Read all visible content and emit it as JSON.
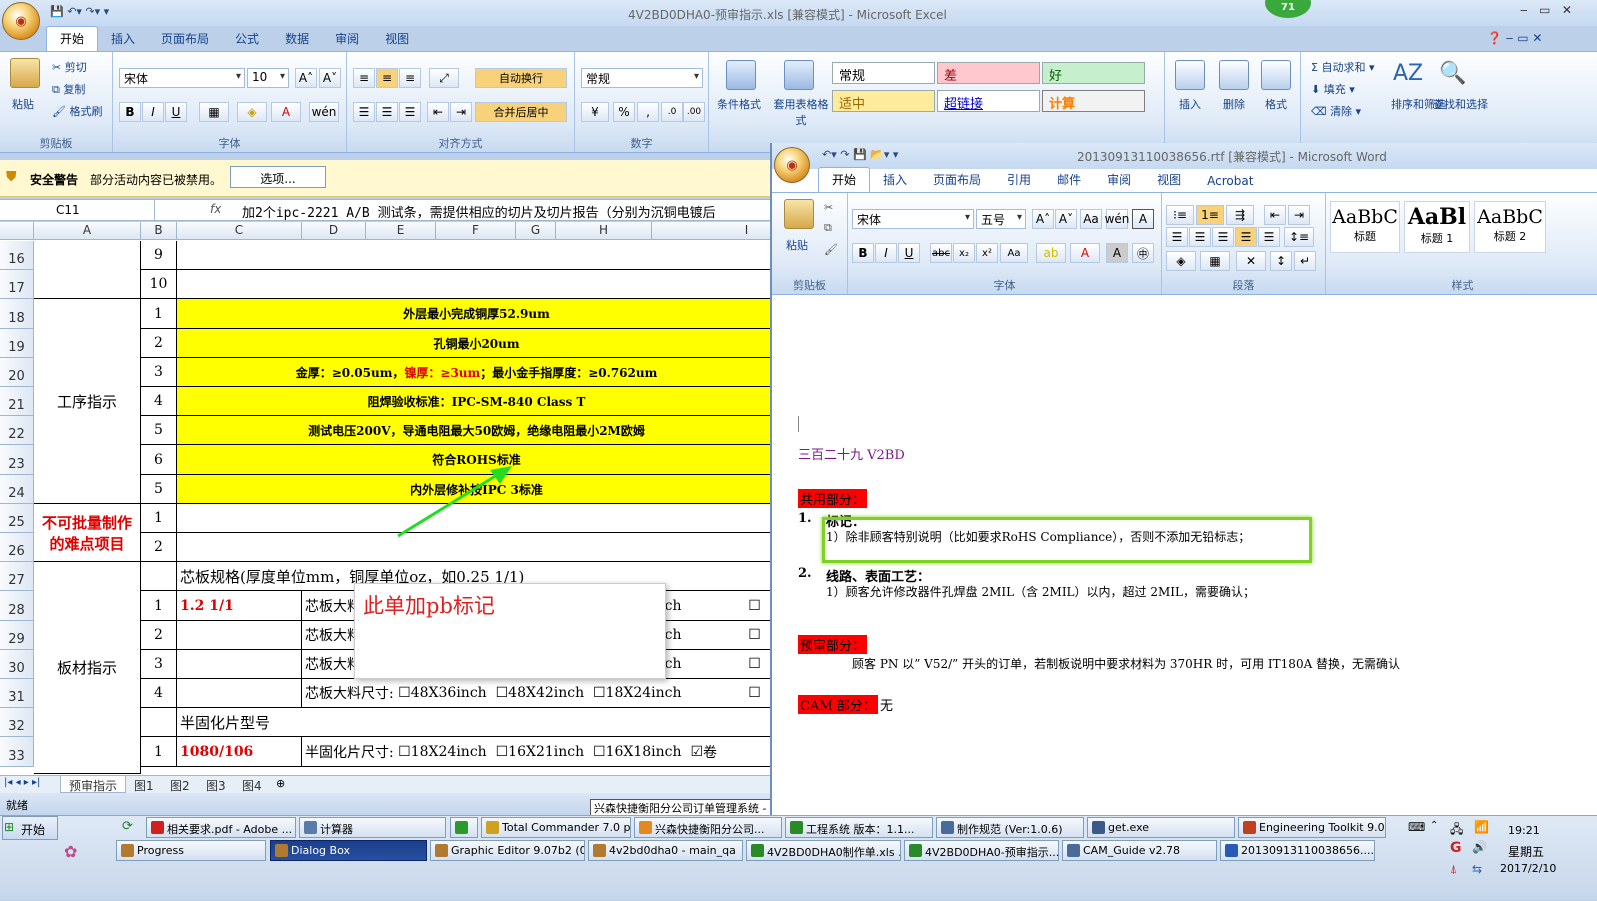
{
  "excel": {
    "title": "4V2BD0DHA0-预审指示.xls  [兼容模式] - Microsoft Excel",
    "tabs": [
      "开始",
      "插入",
      "页面布局",
      "公式",
      "数据",
      "审阅",
      "视图"
    ],
    "clipboard": {
      "paste": "粘贴",
      "cut": "剪切",
      "copy": "复制",
      "format_painter": "格式刷",
      "label": "剪贴板"
    },
    "font": {
      "name": "宋体",
      "size": "10",
      "label": "字体"
    },
    "align": {
      "wrap": "自动换行",
      "merge": "合并后居中",
      "label": "对齐方式"
    },
    "number": {
      "format": "常规",
      "label": "数字"
    },
    "styles": {
      "conditional": "条件格式",
      "table": "套用表格格式",
      "normal": "常规",
      "bad": "差",
      "good": "好",
      "neutral": "适中",
      "hyperlink": "超链接",
      "calc": "计算"
    },
    "cells": {
      "insert": "插入",
      "delete": "删除",
      "format": "格式"
    },
    "editing": {
      "autosum": "自动求和",
      "fill": "填充",
      "clear": "清除",
      "sort": "排序和筛选",
      "find": "查找和选择"
    },
    "security": {
      "title": "安全警告",
      "message": "部分活动内容已被禁用。",
      "options": "选项..."
    },
    "name_box": "C11",
    "fx": "fx",
    "formula": "加2个ipc-2221 A/B 测试条，需提供相应的切片及切片报告（分别为沉铜电镀后",
    "columns": [
      "A",
      "B",
      "C",
      "D",
      "E",
      "F",
      "G",
      "H",
      "I"
    ],
    "rows": [
      "16",
      "17",
      "18",
      "19",
      "20",
      "21",
      "22",
      "23",
      "24",
      "25",
      "26",
      "27",
      "28",
      "29",
      "30",
      "31",
      "32",
      "33"
    ],
    "col_b": [
      "9",
      "10",
      "1",
      "2",
      "3",
      "4",
      "5",
      "6",
      "5",
      "1",
      "2",
      "",
      "1",
      "2",
      "3",
      "4",
      "",
      "1"
    ],
    "process_label": "工序指示",
    "difficult_label_1": "不可批量制作",
    "difficult_label_2": "的难点项目",
    "board_label": "板材指示",
    "yellow": [
      "外层最小完成铜厚52.9um",
      "孔铜最小20um",
      "金厚：≥0.05um，",
      "镍厚：≥3um",
      "；最小金手指厚度：≥0.762um",
      "阻焊验收标准：IPC-SM-840 Class T",
      "测试电压200V，导通电阻最大50欧姆，绝缘电阻最小2M欧姆",
      "符合ROHS标准",
      "内外层修补按IPC 3标准"
    ],
    "core_spec": "芯板规格(厚度单位mm，铜厚单位oz，如0.25 1/1)",
    "core_val": "1.2 1/1",
    "core_size_label": "芯板大料尺寸:",
    "size_opts": [
      "48X36inch",
      "48X42inch",
      "18X24inch"
    ],
    "prepreg_label": "半固化片型号",
    "prepreg_val": "1080/106",
    "prepreg_size_label": "半固化片尺寸:",
    "prepreg_opts": [
      "18X24inch",
      "16X21inch",
      "16X18inch",
      "卷"
    ],
    "popup": "此单加pb标记",
    "sheet_tabs": [
      "预审指示",
      "图1",
      "图2",
      "图3",
      "图4"
    ],
    "status": "就绪",
    "tooltip": "兴森快捷衡阳分公司订单管理系统 - [OA检查]",
    "badge": "71"
  },
  "word": {
    "title": "20130913110038656.rtf [兼容模式] - Microsoft Word",
    "tabs": [
      "开始",
      "插入",
      "页面布局",
      "引用",
      "邮件",
      "审阅",
      "视图",
      "Acrobat"
    ],
    "font": "宋体",
    "size": "五号",
    "groups": {
      "clipboard": "剪贴板",
      "font": "字体",
      "paragraph": "段落",
      "styles": "样式"
    },
    "paste": "粘贴",
    "style_items": [
      {
        "sample": "AaBbC",
        "name": "标题"
      },
      {
        "sample": "AaBl",
        "name": "标题 1"
      },
      {
        "sample": "AaBbC",
        "name": "标题 2"
      }
    ],
    "doc_title": "三百二十九 V2BD",
    "common": "共用部分：",
    "item1_num": "1.",
    "item1": "标记：",
    "item1_sub": "1）除非顾客特别说明（比如要求RoHS Compliance），否则不添加无铅标志；",
    "item2_num": "2.",
    "item2": "线路、表面工艺：",
    "item2_sub": "1）顾客允许修改器件孔焊盘 2MIL（含 2MIL）以内，超过 2MIL，需要确认；",
    "preaudit": "预审部分：",
    "preaudit_text": "顾客 PN 以” V52/” 开头的订单，若制板说明中要求材料为 370HR 时，可用 IT180A 替换，无需确认",
    "cam": "CAM 部分：",
    "cam_text": "无"
  },
  "taskbar": {
    "start": "开始",
    "row1": [
      "相关要求.pdf - Adobe ...",
      "计算器",
      "",
      "Total Commander 7.0 p...",
      "兴森快捷衡阳分公司...",
      "工程系统  版本：1.1...",
      "制作规范 (Ver:1.0.6)",
      "get.exe",
      "Engineering Toolkit 9.0..."
    ],
    "row2": [
      "Progress",
      "Dialog Box",
      "Graphic Editor 9.07b2 (0...",
      "4v2bd0dha0 - main_qa",
      "4V2BD0DHA0制作单.xls ...",
      "4V2BD0DHA0-预审指示....",
      "CAM_Guide v2.78",
      "20130913110038656...."
    ],
    "time": "19:21",
    "weekday": "星期五",
    "date": "2017/2/10"
  }
}
